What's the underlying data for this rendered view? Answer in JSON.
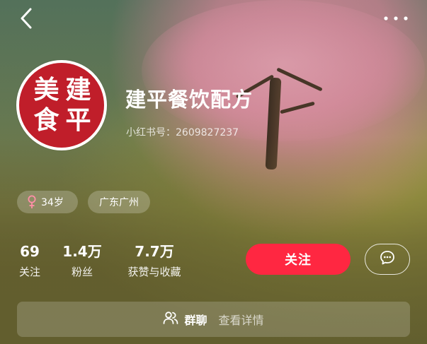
{
  "header": {
    "back_icon": "chevron-left-icon",
    "more_icon": "more-dots-icon"
  },
  "profile": {
    "avatar_chars": [
      "美",
      "建",
      "食",
      "平"
    ],
    "avatar_color": "#c01e2a",
    "nickname": "建平餐饮配方",
    "redid": "小红书号：2609827237"
  },
  "tags": {
    "age": "34岁",
    "gender_icon": "female-icon",
    "location": "广东广州"
  },
  "stats": [
    {
      "value": "69",
      "label": "关注"
    },
    {
      "value": "1.4万",
      "label": "粉丝"
    },
    {
      "value": "7.7万",
      "label": "获赞与收藏"
    }
  ],
  "actions": {
    "follow_label": "关注",
    "follow_color": "#ff2741",
    "chat_icon": "message-bubble-icon"
  },
  "group": {
    "icon": "group-users-icon",
    "title": "群聊",
    "detail": "查看详情"
  }
}
